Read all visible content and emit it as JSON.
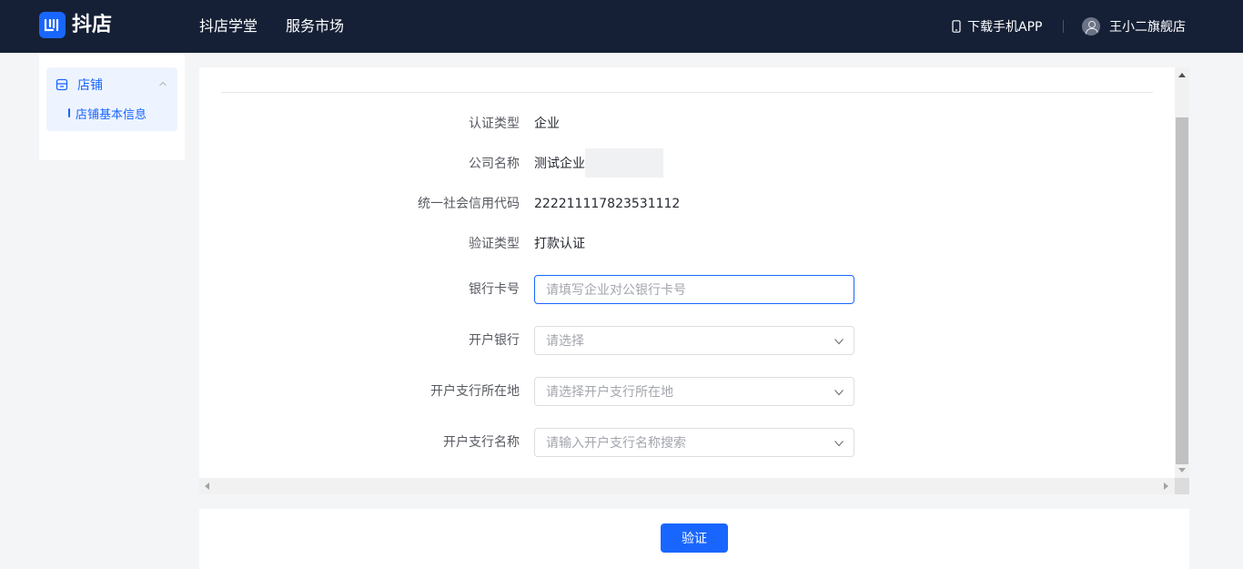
{
  "header": {
    "logo_text": "抖店",
    "nav": [
      "抖店学堂",
      "服务市场"
    ],
    "download_app": "下载手机APP",
    "user_name": "王小二旗舰店"
  },
  "sidebar": {
    "group_label": "店铺",
    "items": [
      {
        "label": "店铺基本信息",
        "active": true
      }
    ]
  },
  "form": {
    "info_rows": [
      {
        "label": "认证类型",
        "value": "企业"
      },
      {
        "label": "公司名称",
        "value": "测试企业"
      },
      {
        "label": "统一社会信用代码",
        "value": "222211117823531112"
      },
      {
        "label": "验证类型",
        "value": "打款认证"
      }
    ],
    "inputs": [
      {
        "label": "银行卡号",
        "placeholder": "请填写企业对公银行卡号",
        "type": "text",
        "focused": true
      },
      {
        "label": "开户银行",
        "placeholder": "请选择",
        "type": "select"
      },
      {
        "label": "开户支行所在地",
        "placeholder": "请选择开户支行所在地",
        "type": "select"
      },
      {
        "label": "开户支行名称",
        "placeholder": "请输入开户支行名称搜索",
        "type": "select"
      }
    ]
  },
  "footer": {
    "verify_label": "验证"
  },
  "colors": {
    "brand": "#1966ff",
    "header_bg": "#152036"
  }
}
